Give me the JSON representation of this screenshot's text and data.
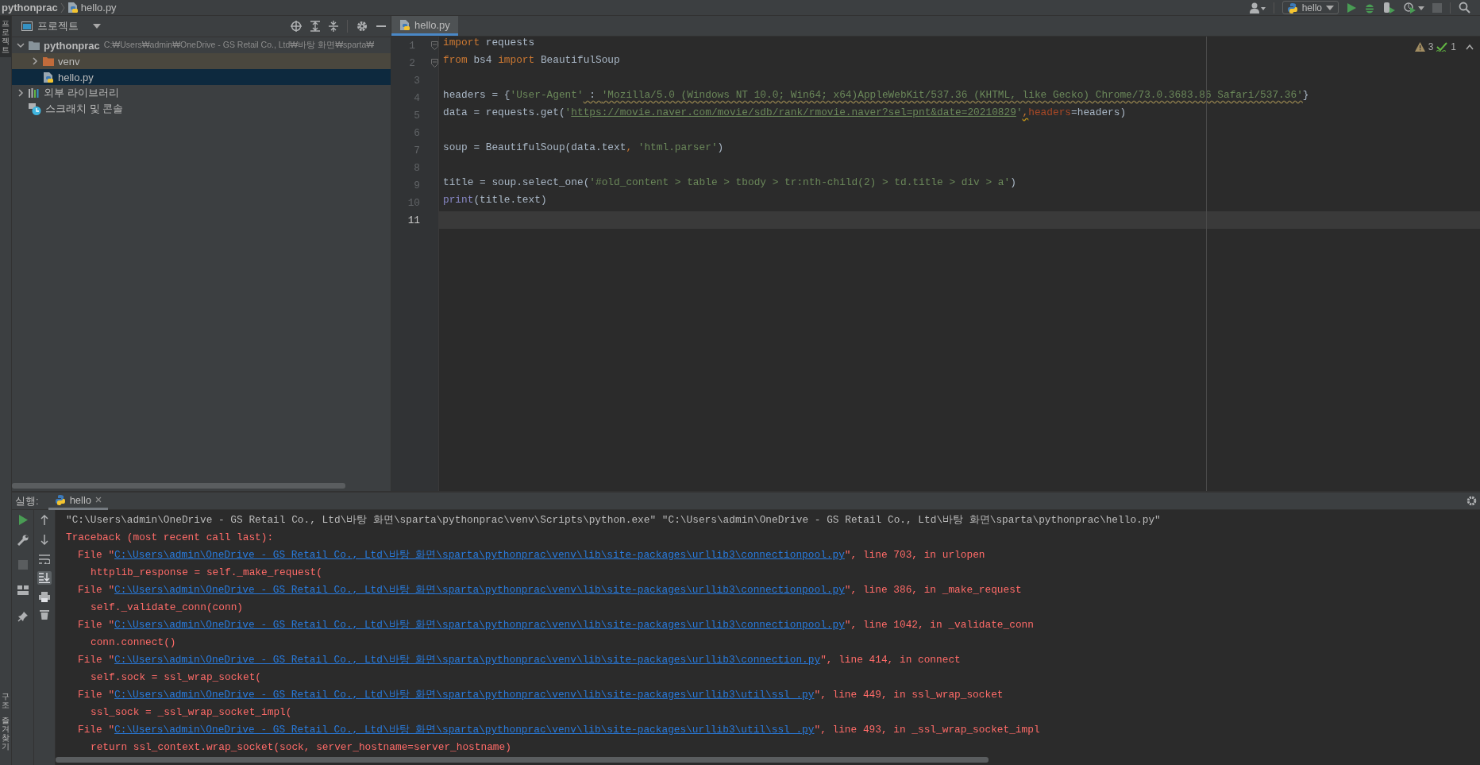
{
  "breadcrumb": [
    {
      "kind": "folder",
      "label": "pythonprac"
    },
    {
      "kind": "file",
      "label": "hello.py"
    }
  ],
  "toolbar": {
    "run_config": "hello"
  },
  "side_tabs_top": [
    {
      "label": "프로젝트",
      "selected": true
    }
  ],
  "side_tabs_bottom": [
    {
      "label": "구조",
      "selected": false
    },
    {
      "label": "즐겨찾기",
      "selected": false
    }
  ],
  "project": {
    "title": "프로젝트",
    "tree": [
      {
        "kind": "folder",
        "label": "pythonprac",
        "detail": "C:₩Users₩admin₩OneDrive - GS Retail Co., Ltd₩바탕 화면₩sparta₩",
        "expanded": true,
        "selected": false,
        "excluded": false,
        "children": [
          {
            "kind": "folder",
            "label": "venv",
            "expanded": false,
            "selected": false,
            "excluded": true
          },
          {
            "kind": "file",
            "label": "hello.py",
            "selected": true,
            "excluded": false
          }
        ]
      },
      {
        "kind": "libraries",
        "label": "외부 라이브러리",
        "expanded": false,
        "selected": false,
        "excluded": false
      },
      {
        "kind": "scratches",
        "label": "스크래치 및 콘솔",
        "selected": false,
        "excluded": false
      }
    ]
  },
  "editor": {
    "tabs": [
      {
        "label": "hello.py",
        "selected": true
      }
    ],
    "inspections": {
      "warnings": "3",
      "weak": "1"
    },
    "lines": [
      {
        "number": "1",
        "fold": true,
        "current": false,
        "tokens": [
          {
            "kind": "keyword",
            "text": "import"
          },
          {
            "kind": "plain",
            "text": " requests"
          }
        ]
      },
      {
        "number": "2",
        "fold": true,
        "current": false,
        "tokens": [
          {
            "kind": "keyword",
            "text": "from"
          },
          {
            "kind": "plain",
            "text": " bs4 "
          },
          {
            "kind": "keyword",
            "text": "import"
          },
          {
            "kind": "plain",
            "text": " BeautifulSoup"
          }
        ]
      },
      {
        "number": "3",
        "fold": false,
        "current": false
      },
      {
        "number": "4",
        "fold": false,
        "current": false,
        "tokens": [
          {
            "kind": "plain",
            "text": "headers = {"
          },
          {
            "kind": "string",
            "text": "'User-Agent'"
          },
          {
            "kind": "warn",
            "text": " : "
          },
          {
            "kind": "warnstring",
            "text": "'Mozilla/5.0 (Windows NT 10.0; Win64; x64)AppleWebKit/537.36 (KHTML, like Gecko) Chrome/73.0.3683.86 Safari/537.36'"
          },
          {
            "kind": "plain",
            "text": "}"
          }
        ]
      },
      {
        "number": "5",
        "fold": false,
        "current": false,
        "tokens": [
          {
            "kind": "plain",
            "text": "data = requests.get("
          },
          {
            "kind": "string",
            "text": "'"
          },
          {
            "kind": "url",
            "text": "https://movie.naver.com/movie/sdb/rank/rmovie.naver?sel=pnt&date=20210829"
          },
          {
            "kind": "string",
            "text": "'"
          },
          {
            "kind": "warncomma",
            "text": ","
          },
          {
            "kind": "param",
            "text": "headers"
          },
          {
            "kind": "plain",
            "text": "=headers)"
          }
        ]
      },
      {
        "number": "6",
        "fold": false,
        "current": false
      },
      {
        "number": "7",
        "fold": false,
        "current": false,
        "tokens": [
          {
            "kind": "plain",
            "text": "soup = BeautifulSoup(data.text"
          },
          {
            "kind": "comma",
            "text": ", "
          },
          {
            "kind": "string",
            "text": "'html.parser'"
          },
          {
            "kind": "plain",
            "text": ")"
          }
        ]
      },
      {
        "number": "8",
        "fold": false,
        "current": false
      },
      {
        "number": "9",
        "fold": false,
        "current": false,
        "tokens": [
          {
            "kind": "plain",
            "text": "title = soup.select_one("
          },
          {
            "kind": "string",
            "text": "'#old_content > table > tbody > tr:nth-child(2) > td.title > div > a'"
          },
          {
            "kind": "plain",
            "text": ")"
          }
        ]
      },
      {
        "number": "10",
        "fold": false,
        "current": false,
        "tokens": [
          {
            "kind": "builtin",
            "text": "print"
          },
          {
            "kind": "plain",
            "text": "(title.text)"
          }
        ]
      },
      {
        "number": "11",
        "fold": false,
        "current": true
      }
    ]
  },
  "run": {
    "label": "실행:",
    "tabs": [
      {
        "label": "hello",
        "selected": true
      }
    ],
    "scroll_to_end": true,
    "output": [
      {
        "kind": "command",
        "text": "\"C:\\Users\\admin\\OneDrive - GS Retail Co., Ltd\\바탕 화면\\sparta\\pythonprac\\venv\\Scripts\\python.exe\" \"C:\\Users\\admin\\OneDrive - GS Retail Co., Ltd\\바탕 화면\\sparta\\pythonprac\\hello.py\""
      },
      {
        "kind": "error",
        "text": "Traceback (most recent call last):"
      },
      {
        "kind": "frame",
        "prefix": "File \"",
        "link": "C:\\Users\\admin\\OneDrive - GS Retail Co., Ltd\\바탕 화면\\sparta\\pythonprac\\venv\\lib\\site-packages\\urllib3\\connectionpool.py",
        "suffix": "\", line 703, in urlopen"
      },
      {
        "kind": "source",
        "text": "httplib_response = self._make_request("
      },
      {
        "kind": "frame",
        "prefix": "File \"",
        "link": "C:\\Users\\admin\\OneDrive - GS Retail Co., Ltd\\바탕 화면\\sparta\\pythonprac\\venv\\lib\\site-packages\\urllib3\\connectionpool.py",
        "suffix": "\", line 386, in _make_request"
      },
      {
        "kind": "source",
        "text": "self._validate_conn(conn)"
      },
      {
        "kind": "frame",
        "prefix": "File \"",
        "link": "C:\\Users\\admin\\OneDrive - GS Retail Co., Ltd\\바탕 화면\\sparta\\pythonprac\\venv\\lib\\site-packages\\urllib3\\connectionpool.py",
        "suffix": "\", line 1042, in _validate_conn"
      },
      {
        "kind": "source",
        "text": "conn.connect()"
      },
      {
        "kind": "frame",
        "prefix": "File \"",
        "link": "C:\\Users\\admin\\OneDrive - GS Retail Co., Ltd\\바탕 화면\\sparta\\pythonprac\\venv\\lib\\site-packages\\urllib3\\connection.py",
        "suffix": "\", line 414, in connect"
      },
      {
        "kind": "source",
        "text": "self.sock = ssl_wrap_socket("
      },
      {
        "kind": "frame",
        "prefix": "File \"",
        "link": "C:\\Users\\admin\\OneDrive - GS Retail Co., Ltd\\바탕 화면\\sparta\\pythonprac\\venv\\lib\\site-packages\\urllib3\\util\\ssl_.py",
        "suffix": "\", line 449, in ssl_wrap_socket"
      },
      {
        "kind": "source",
        "text": "ssl_sock = _ssl_wrap_socket_impl("
      },
      {
        "kind": "frame",
        "prefix": "File \"",
        "link": "C:\\Users\\admin\\OneDrive - GS Retail Co., Ltd\\바탕 화면\\sparta\\pythonprac\\venv\\lib\\site-packages\\urllib3\\util\\ssl_.py",
        "suffix": "\", line 493, in _ssl_wrap_socket_impl"
      },
      {
        "kind": "source",
        "text": "return ssl_context.wrap_socket(sock, server_hostname=server_hostname)"
      }
    ]
  }
}
